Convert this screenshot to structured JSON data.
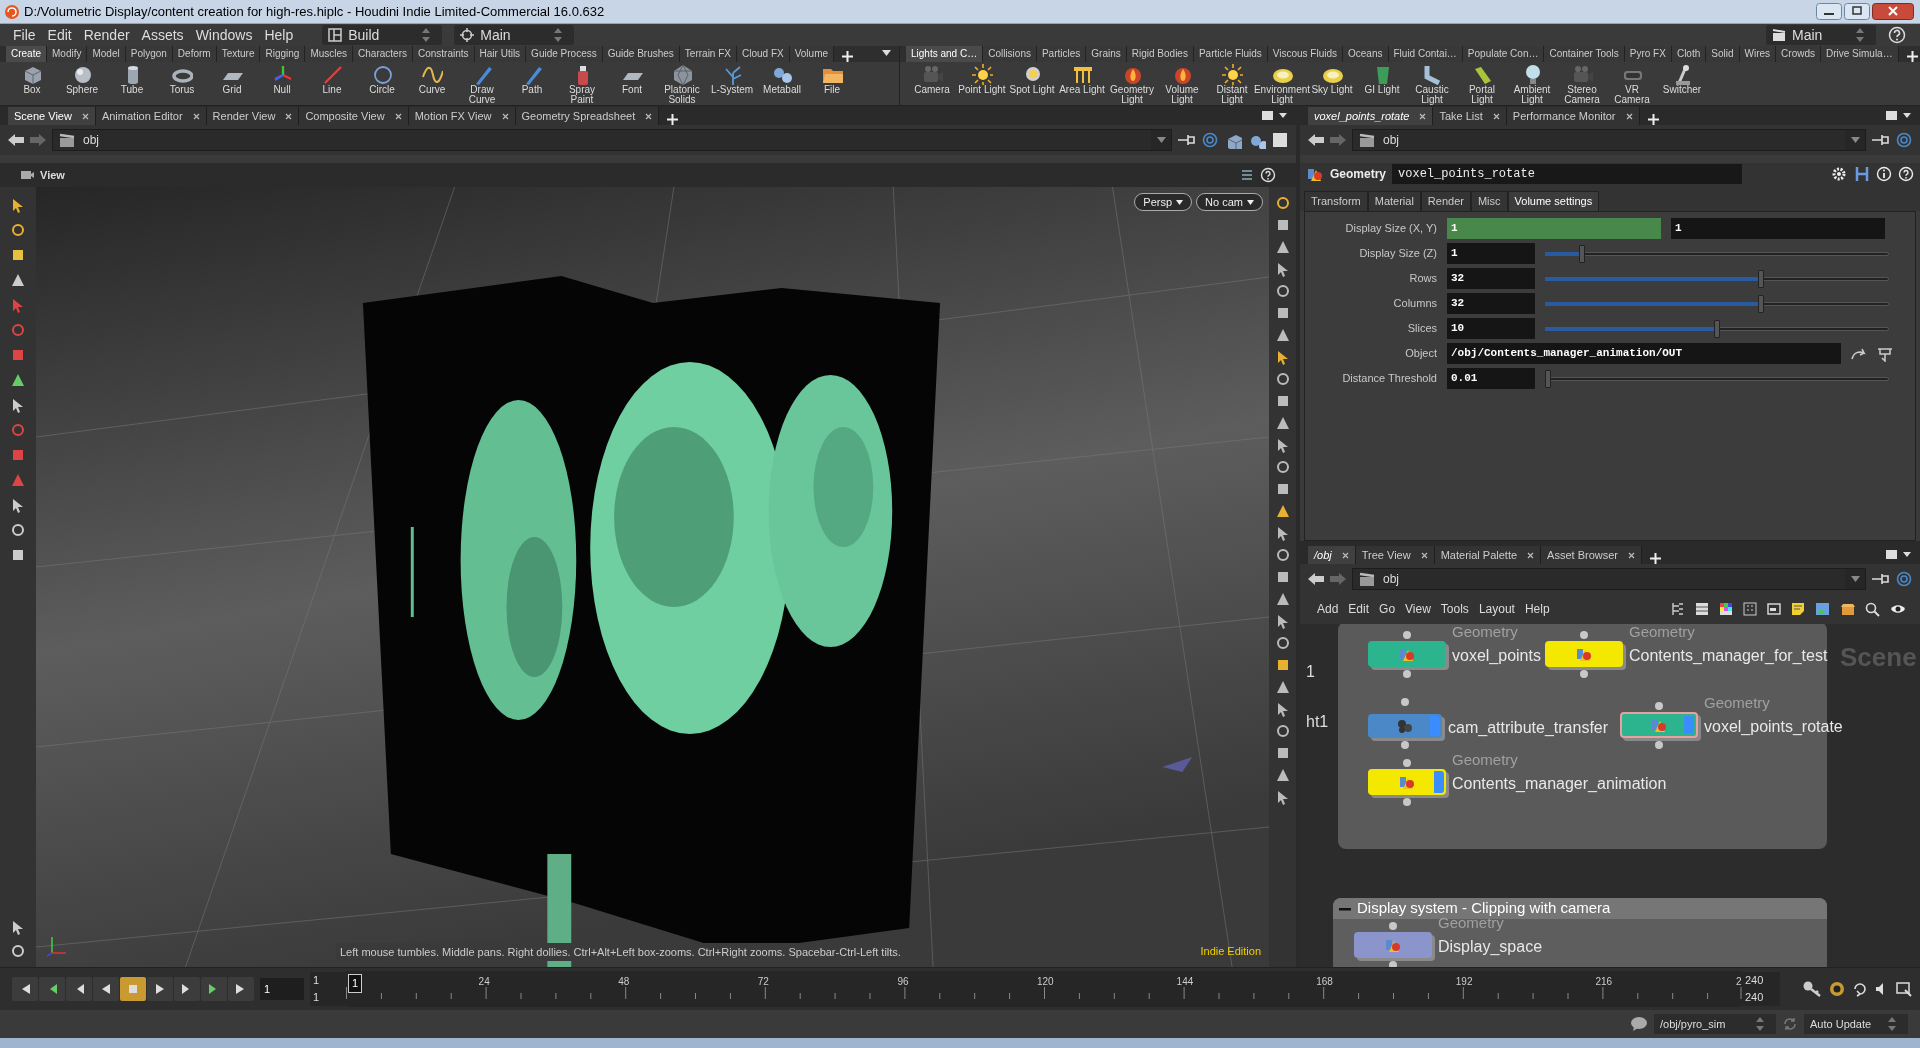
{
  "window": {
    "title": "D:/Volumetric Display/content creation for high-res.hiplc - Houdini Indie Limited-Commercial 16.0.632"
  },
  "menu": [
    "File",
    "Edit",
    "Render",
    "Assets",
    "Windows",
    "Help"
  ],
  "desktop": "Build",
  "update_context": "Main",
  "right_context": "Main",
  "shelves": [
    {
      "tabs": [
        {
          "label": "Create",
          "selected": true
        },
        {
          "label": "Modify",
          "selected": false
        },
        {
          "label": "Model",
          "selected": false
        },
        {
          "label": "Polygon",
          "selected": false
        },
        {
          "label": "Deform",
          "selected": false
        },
        {
          "label": "Texture",
          "selected": false
        },
        {
          "label": "Rigging",
          "selected": false
        },
        {
          "label": "Muscles",
          "selected": false
        },
        {
          "label": "Characters",
          "selected": false
        },
        {
          "label": "Constraints",
          "selected": false
        },
        {
          "label": "Hair Utils",
          "selected": false
        },
        {
          "label": "Guide Process",
          "selected": false
        },
        {
          "label": "Guide Brushes",
          "selected": false
        },
        {
          "label": "Terrain FX",
          "selected": false
        },
        {
          "label": "Cloud FX",
          "selected": false
        },
        {
          "label": "Volume",
          "selected": false
        }
      ],
      "tools": [
        "Box",
        "Sphere",
        "Tube",
        "Torus",
        "Grid",
        "Null",
        "Line",
        "Circle",
        "Curve",
        "Draw Curve",
        "Path",
        "Spray Paint",
        "Font",
        "Platonic Solids",
        "L-System",
        "Metaball",
        "File"
      ]
    },
    {
      "tabs": [
        {
          "label": "Lights and C…",
          "selected": true
        },
        {
          "label": "Collisions",
          "selected": false
        },
        {
          "label": "Particles",
          "selected": false
        },
        {
          "label": "Grains",
          "selected": false
        },
        {
          "label": "Rigid Bodies",
          "selected": false
        },
        {
          "label": "Particle Fluids",
          "selected": false
        },
        {
          "label": "Viscous Fluids",
          "selected": false
        },
        {
          "label": "Oceans",
          "selected": false
        },
        {
          "label": "Fluid Contai…",
          "selected": false
        },
        {
          "label": "Populate Con…",
          "selected": false
        },
        {
          "label": "Container Tools",
          "selected": false
        },
        {
          "label": "Pyro FX",
          "selected": false
        },
        {
          "label": "Cloth",
          "selected": false
        },
        {
          "label": "Solid",
          "selected": false
        },
        {
          "label": "Wires",
          "selected": false
        },
        {
          "label": "Crowds",
          "selected": false
        },
        {
          "label": "Drive Simula…",
          "selected": false
        }
      ],
      "tools": [
        "Camera",
        "Point Light",
        "Spot Light",
        "Area Light",
        "Geometry Light",
        "Volume Light",
        "Distant Light",
        "Environment Light",
        "Sky Light",
        "GI Light",
        "Caustic Light",
        "Portal Light",
        "Ambient Light",
        "Stereo Camera",
        "VR Camera",
        "Switcher"
      ]
    }
  ],
  "scene_pane": {
    "tabs": [
      {
        "label": "Scene View",
        "selected": true
      },
      {
        "label": "Animation Editor",
        "selected": false
      },
      {
        "label": "Render View",
        "selected": false
      },
      {
        "label": "Composite View",
        "selected": false
      },
      {
        "label": "Motion FX View",
        "selected": false
      },
      {
        "label": "Geometry Spreadsheet",
        "selected": false
      }
    ],
    "path": "obj",
    "viewer": {
      "title": "View",
      "menus": [
        "Persp",
        "No cam"
      ],
      "hint": "Left mouse tumbles. Middle pans. Right dollies. Ctrl+Alt+Left box-zooms. Ctrl+Right zooms. Spacebar-Ctrl-Left tilts.",
      "edition": "Indie Edition"
    }
  },
  "parameters": {
    "tabs": [
      {
        "label": "voxel_points_rotate",
        "selected": true
      },
      {
        "label": "Take List",
        "selected": false
      },
      {
        "label": "Performance Monitor",
        "selected": false
      }
    ],
    "path": "obj",
    "node_type": "Geometry",
    "node_name": "voxel_points_rotate",
    "folders": [
      {
        "label": "Transform",
        "selected": false
      },
      {
        "label": "Material",
        "selected": false
      },
      {
        "label": "Render",
        "selected": false
      },
      {
        "label": "Misc",
        "selected": false
      },
      {
        "label": "Volume settings",
        "selected": true
      }
    ],
    "params": [
      {
        "label": "Display Size (X, Y)",
        "kind": "vector",
        "values": [
          {
            "text": "1",
            "animated": true
          },
          {
            "text": "1",
            "animated": false
          }
        ]
      },
      {
        "label": "Display Size (Z)",
        "kind": "slider",
        "value": "1",
        "level": 0.1
      },
      {
        "label": "Rows",
        "kind": "slider",
        "value": "32",
        "level": 0.63
      },
      {
        "label": "Columns",
        "kind": "slider",
        "value": "32",
        "level": 0.63
      },
      {
        "label": "Slices",
        "kind": "slider",
        "value": "10",
        "level": 0.5
      },
      {
        "label": "Object",
        "kind": "path",
        "value": "/obj/Contents_manager_animation/OUT"
      },
      {
        "label": "Distance Threshold",
        "kind": "slider",
        "value": "0.01",
        "level": 0
      }
    ]
  },
  "network": {
    "tabs": [
      {
        "label": "/obj",
        "selected": true
      },
      {
        "label": "Tree View",
        "selected": false
      },
      {
        "label": "Material Palette",
        "selected": false
      },
      {
        "label": "Asset Browser",
        "selected": false
      }
    ],
    "path": "obj",
    "menu": [
      "Add",
      "Edit",
      "Go",
      "View",
      "Tools",
      "Layout",
      "Help"
    ],
    "cut_labels": [
      "1",
      "ht1"
    ],
    "context_label": "Scene",
    "boxes": [
      {
        "nodes": [
          {
            "name": "voxel_points",
            "type": "Geometry",
            "kind": "geometry",
            "color": "#2bb48e",
            "display": false,
            "selected": false
          },
          {
            "name": "Contents_manager_for_test",
            "type": "Geometry",
            "kind": "geometry",
            "color": "#f5e800",
            "display": false,
            "selected": false
          },
          {
            "name": "cam_attribute_transfer",
            "kind": "subnet",
            "color": "#4a88c8",
            "display": true,
            "selected": false
          },
          {
            "name": "voxel_points_rotate",
            "type": "Geometry",
            "kind": "geometry",
            "color": "#2bb48e",
            "display": true,
            "selected": true
          },
          {
            "name": "Contents_manager_animation",
            "type": "Geometry",
            "kind": "geometry",
            "color": "#f5e800",
            "display": true,
            "selected": false
          }
        ]
      },
      {
        "title": "Display system - Clipping with camera",
        "nodes": [
          {
            "name": "Display_space",
            "type": "Geometry",
            "kind": "geometry",
            "color": "#8c94cc",
            "display": false,
            "selected": false
          }
        ]
      }
    ]
  },
  "timeline": {
    "stopped": true,
    "frame": "1",
    "start": [
      "1",
      "1"
    ],
    "cursor": "1",
    "ticks": [
      "24",
      "48",
      "72",
      "96",
      "120",
      "144",
      "168",
      "192",
      "216",
      "2"
    ],
    "end": [
      "240",
      "240"
    ]
  },
  "status_bar": {
    "path": "/obj/pyro_sim",
    "update_mode": "Auto Update"
  }
}
